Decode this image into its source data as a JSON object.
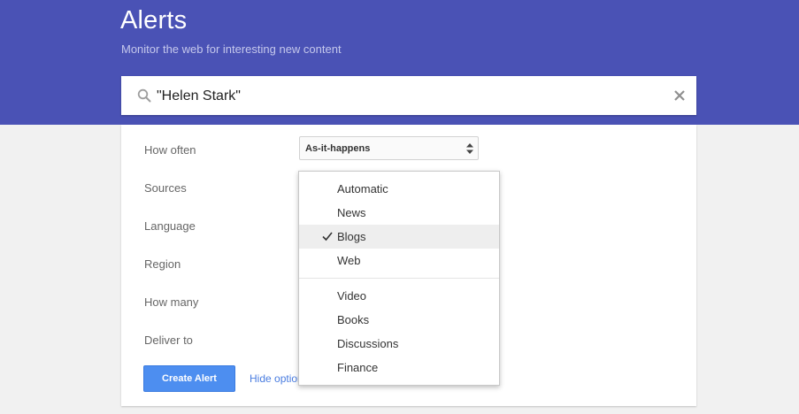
{
  "header": {
    "title": "Alerts",
    "subtitle": "Monitor the web for interesting new content",
    "background_color": "#4a52b5"
  },
  "search": {
    "value": "\"Helen Stark\"",
    "search_icon": "search-icon",
    "clear_icon": "close-icon"
  },
  "options": {
    "labels": [
      "How often",
      "Sources",
      "Language",
      "Region",
      "How many",
      "Deliver to"
    ],
    "how_often_value": "As-it-happens",
    "create_button_label": "Create Alert",
    "hide_options_label": "Hide options",
    "button_color": "#4d8ef0"
  },
  "sources_dropdown": {
    "group1": [
      "Automatic",
      "News",
      "Blogs",
      "Web"
    ],
    "group2": [
      "Video",
      "Books",
      "Discussions",
      "Finance"
    ],
    "selected": "Blogs"
  }
}
